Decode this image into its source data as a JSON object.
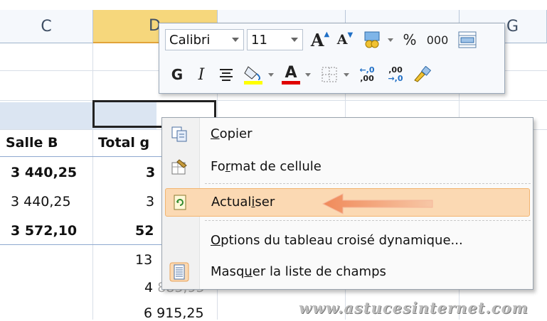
{
  "sheet": {
    "columns": [
      "C",
      "D",
      "G"
    ],
    "row_labels": [
      "Salle B",
      "Total g"
    ],
    "values": [
      "3 440,25",
      "3 440,25",
      "3 572,10"
    ],
    "total_partials": [
      "3",
      "3",
      "52",
      "13",
      "4 ",
      "6 915,25"
    ],
    "partial_extra": "885,95"
  },
  "minitoolbar": {
    "font_name": "Calibri",
    "font_size": "11",
    "grow_font": "A",
    "shrink_font": "A",
    "percent": "%",
    "thousands": "000",
    "bold": "G",
    "italic": "I",
    "font_color_letter": "A",
    "inc_decimal_top": "←,0",
    "inc_decimal_bottom": ",00",
    "dec_decimal_top": ",00",
    "dec_decimal_bottom": "→,0"
  },
  "context_menu": {
    "items": [
      {
        "label": "Copier",
        "accel": "C",
        "rest": "opier"
      },
      {
        "label": "Format de cellule",
        "pre": "Fo",
        "accel": "r",
        "rest": "mat de cellule"
      },
      {
        "label": "Actualiser",
        "pre": "Actual",
        "accel": "i",
        "rest": "ser"
      },
      {
        "label": "Options du tableau croisé dynamique...",
        "accel": "O",
        "rest": "ptions du tableau croisé dynamique..."
      },
      {
        "label": "Masquer la liste de champs",
        "pre": "Masq",
        "accel": "u",
        "rest": "er la liste de champs"
      }
    ]
  },
  "watermark": "www.astucesinternet.com",
  "colors": {
    "highlight": "#fbd9b3",
    "arrow": "#f4b183",
    "selected_header": "#f6d77c"
  }
}
